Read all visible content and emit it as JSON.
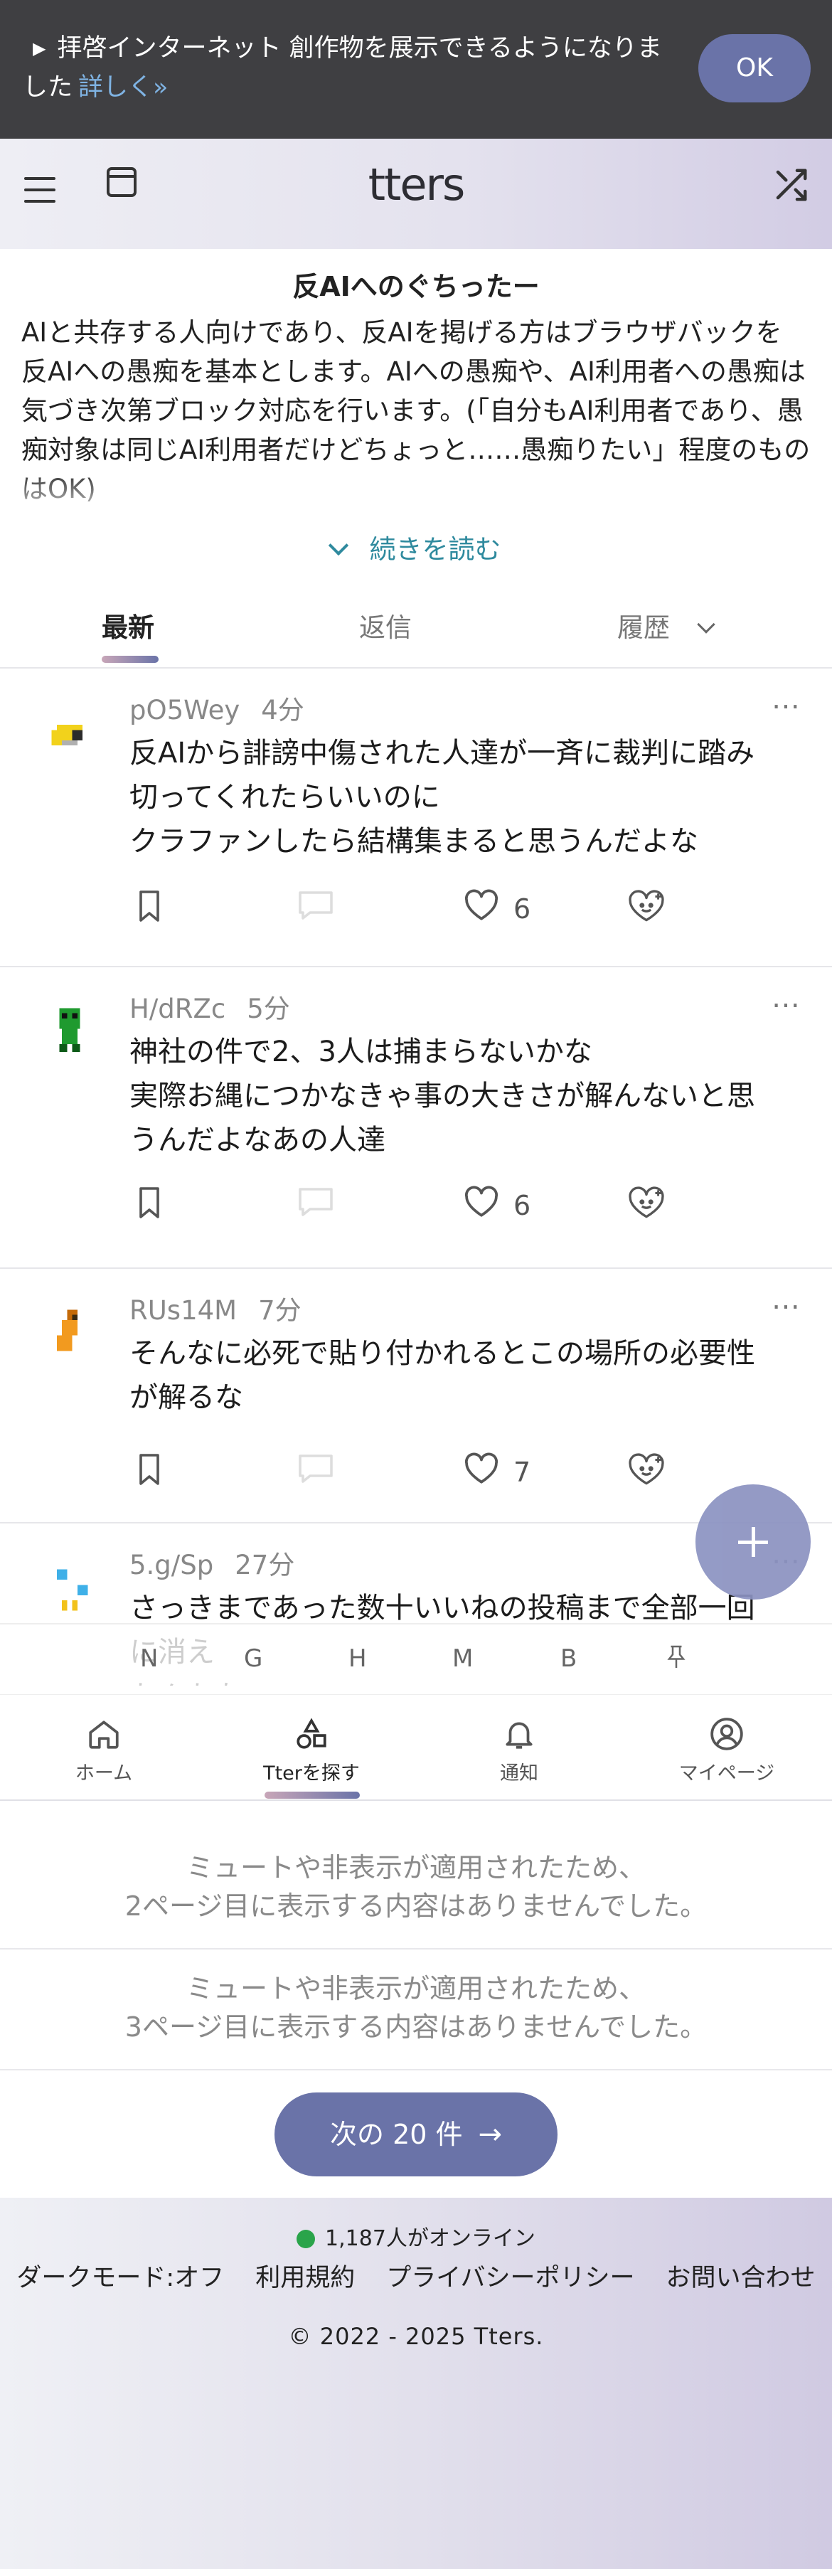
{
  "notice": {
    "text": "拝啓インターネット 創作物を展示できるようになりました",
    "link_label": "詳しく»",
    "ok_label": "OK"
  },
  "header": {
    "logo": "tters"
  },
  "board": {
    "title": "反AIへのぐちったー",
    "description": "AIと共存する人向けであり、反AIを掲げる方はブラウザバックを\n反AIへの愚痴を基本とします。AIへの愚痴や、AI利用者への愚痴は気づき次第ブロック対応を行います。(「自分もAI利用者であり、愚痴対象は同じAI利用者だけどちょっと……愚痴りたい」程度のものはOK)",
    "read_more": "続きを読む"
  },
  "tabs": {
    "latest": "最新",
    "replies": "返信",
    "history": "履歴"
  },
  "posts": [
    {
      "user": "pO5Wey",
      "time": "4分",
      "body": "反AIから誹謗中傷された人達が一斉に裁判に踏み切ってくれたらいいのに\nクラファンしたら結構集まると思うんだよな",
      "likes": "6",
      "avatar_colors": [
        "#f2d21b",
        "#2b2b2b",
        "#b0b0b0"
      ]
    },
    {
      "user": "H/dRZc",
      "time": "5分",
      "body": "神社の件で2、3人は捕まらないかな\n実際お縄につかなきゃ事の大きさが解んないと思うんだよなあの人達",
      "likes": "6",
      "avatar_colors": [
        "#1f9a2f",
        "#0d5a17",
        "#111111"
      ]
    },
    {
      "user": "RUs14M",
      "time": "7分",
      "body": "そんなに必死で貼り付かれるとこの場所の必要性が解るな",
      "likes": "7",
      "avatar_colors": [
        "#f29a1f",
        "#c46a08",
        "#3a2a10"
      ]
    },
    {
      "user": "5.g/Sp",
      "time": "27分",
      "body": "さっきまであった数十いいねの投稿まで全部一回に消え\nたんかな",
      "likes": "",
      "avatar_colors": [
        "#3fb0e8",
        "#ffffff",
        "#f2c21b"
      ]
    }
  ],
  "index_letters": [
    "N",
    "G",
    "H",
    "M",
    "B"
  ],
  "bottom_nav": {
    "home": "ホーム",
    "explore": "Tterを探す",
    "notifications": "通知",
    "mypage": "マイページ"
  },
  "muted_notes": [
    "ミュートや非表示が適用されたため、\n2ページ目に表示する内容はありませんでした。",
    "ミュートや非表示が適用されたため、\n3ページ目に表示する内容はありませんでした。"
  ],
  "next_button": {
    "label": "次の 20 件",
    "arrow": "→"
  },
  "footer": {
    "online": "1,187人がオンライン",
    "links": [
      "ダークモード:オフ",
      "利用規約",
      "プライバシーポリシー",
      "お問い合わせ"
    ],
    "copyright": "© 2022 - 2025 Tters."
  },
  "colors": {
    "accent": "#6a73a8",
    "link": "#2f8a9e",
    "online_dot": "#2aa44a"
  }
}
